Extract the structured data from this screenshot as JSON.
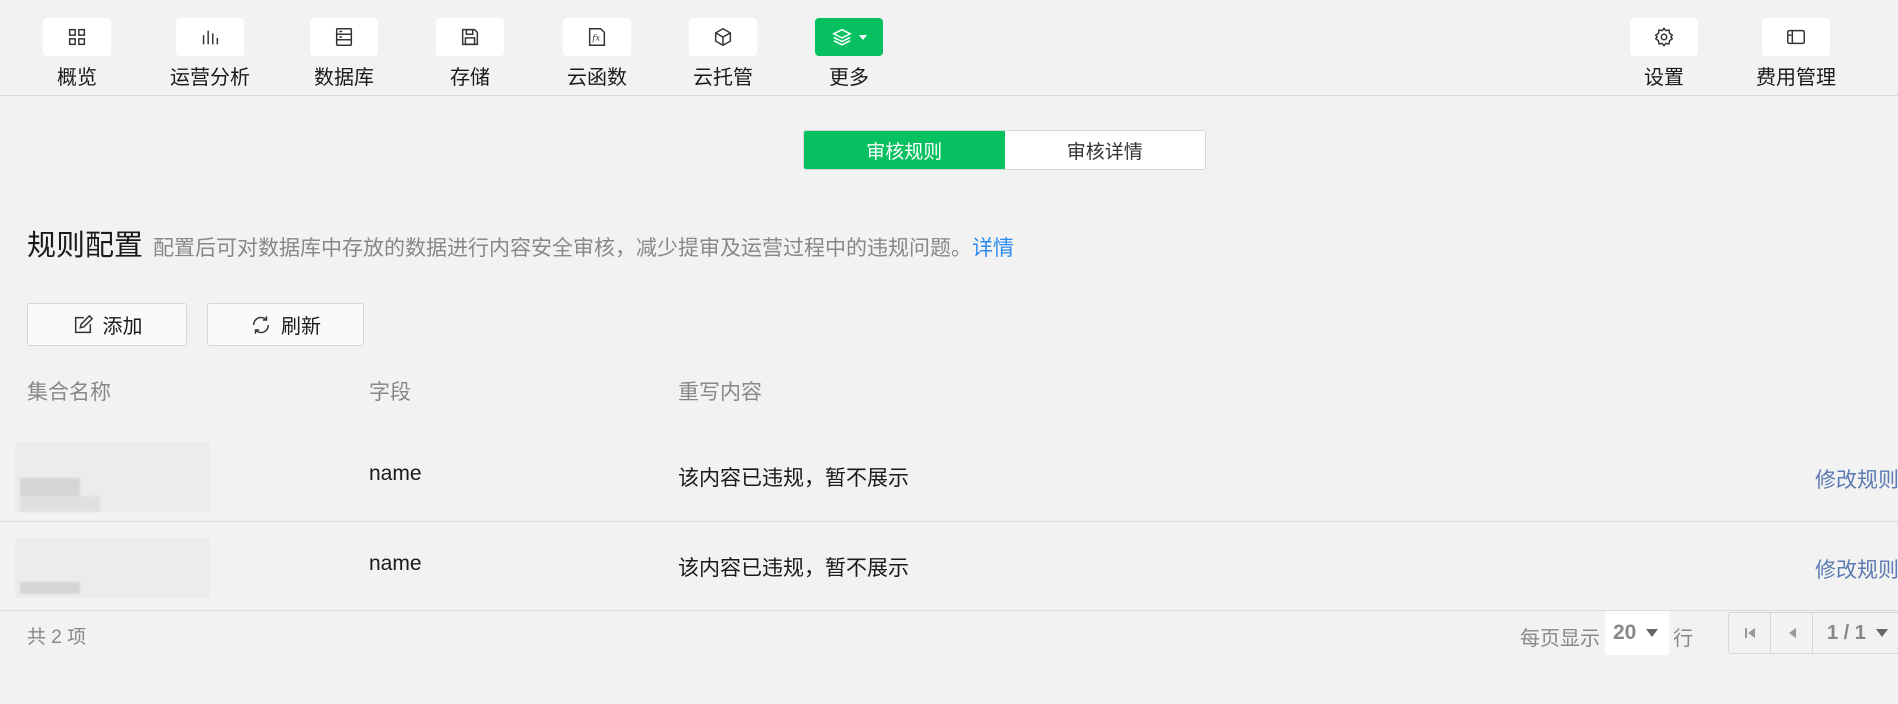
{
  "toolbar": {
    "items": [
      {
        "label": "概览",
        "icon": "overview-grid-icon"
      },
      {
        "label": "运营分析",
        "icon": "bar-chart-icon"
      },
      {
        "label": "数据库",
        "icon": "database-icon"
      },
      {
        "label": "存储",
        "icon": "save-disk-icon"
      },
      {
        "label": "云函数",
        "icon": "function-fx-icon"
      },
      {
        "label": "云托管",
        "icon": "cube-box-icon"
      },
      {
        "label": "更多",
        "icon": "layers-icon"
      },
      {
        "label": "设置",
        "icon": "gear-icon"
      },
      {
        "label": "费用管理",
        "icon": "billing-card-icon"
      }
    ],
    "accent": "#07c160"
  },
  "tabs": {
    "items": [
      "审核规则",
      "审核详情"
    ],
    "active": "审核规则"
  },
  "heading": {
    "title": "规则配置",
    "description": "配置后可对数据库中存放的数据进行内容安全审核，减少提审及运营过程中的违规问题。",
    "link": "详情",
    "link_color": "#2d8cf0"
  },
  "actions": {
    "add_label": "添加",
    "refresh_label": "刷新"
  },
  "table": {
    "columns": [
      "集合名称",
      "字段",
      "重写内容"
    ],
    "rows": [
      {
        "collection": "",
        "field": "name",
        "rewrite": "该内容已违规，暂不展示",
        "action": "修改规则"
      },
      {
        "collection": "",
        "field": "name",
        "rewrite": "该内容已违规，暂不展示",
        "action": "修改规则"
      }
    ]
  },
  "footer": {
    "total": "共 2 项",
    "per_page_label": "每页显示",
    "per_page_value": "20",
    "per_page_unit": "行",
    "page_indicator": "1 / 1"
  }
}
